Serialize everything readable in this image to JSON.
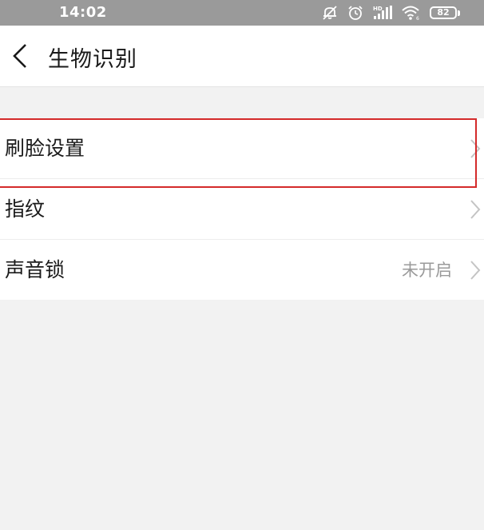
{
  "status_bar": {
    "time": "14:02",
    "battery_level": "82",
    "icons": [
      "mute-icon",
      "alarm-icon",
      "signal-hd-icon",
      "wifi-icon",
      "battery-icon"
    ]
  },
  "header": {
    "back_icon": "chevron-left-icon",
    "title": "生物识别"
  },
  "settings": {
    "items": [
      {
        "label": "刷脸设置",
        "value": "",
        "icon": "chevron-right-icon",
        "highlighted": true
      },
      {
        "label": "指纹",
        "value": "",
        "icon": "chevron-right-icon"
      },
      {
        "label": "声音锁",
        "value": "未开启",
        "icon": "chevron-right-icon"
      }
    ]
  },
  "colors": {
    "status_bar": "#9a9a9a",
    "background": "#f2f2f2",
    "highlight": "#d42a2a",
    "secondary_text": "#9a9a9a"
  }
}
